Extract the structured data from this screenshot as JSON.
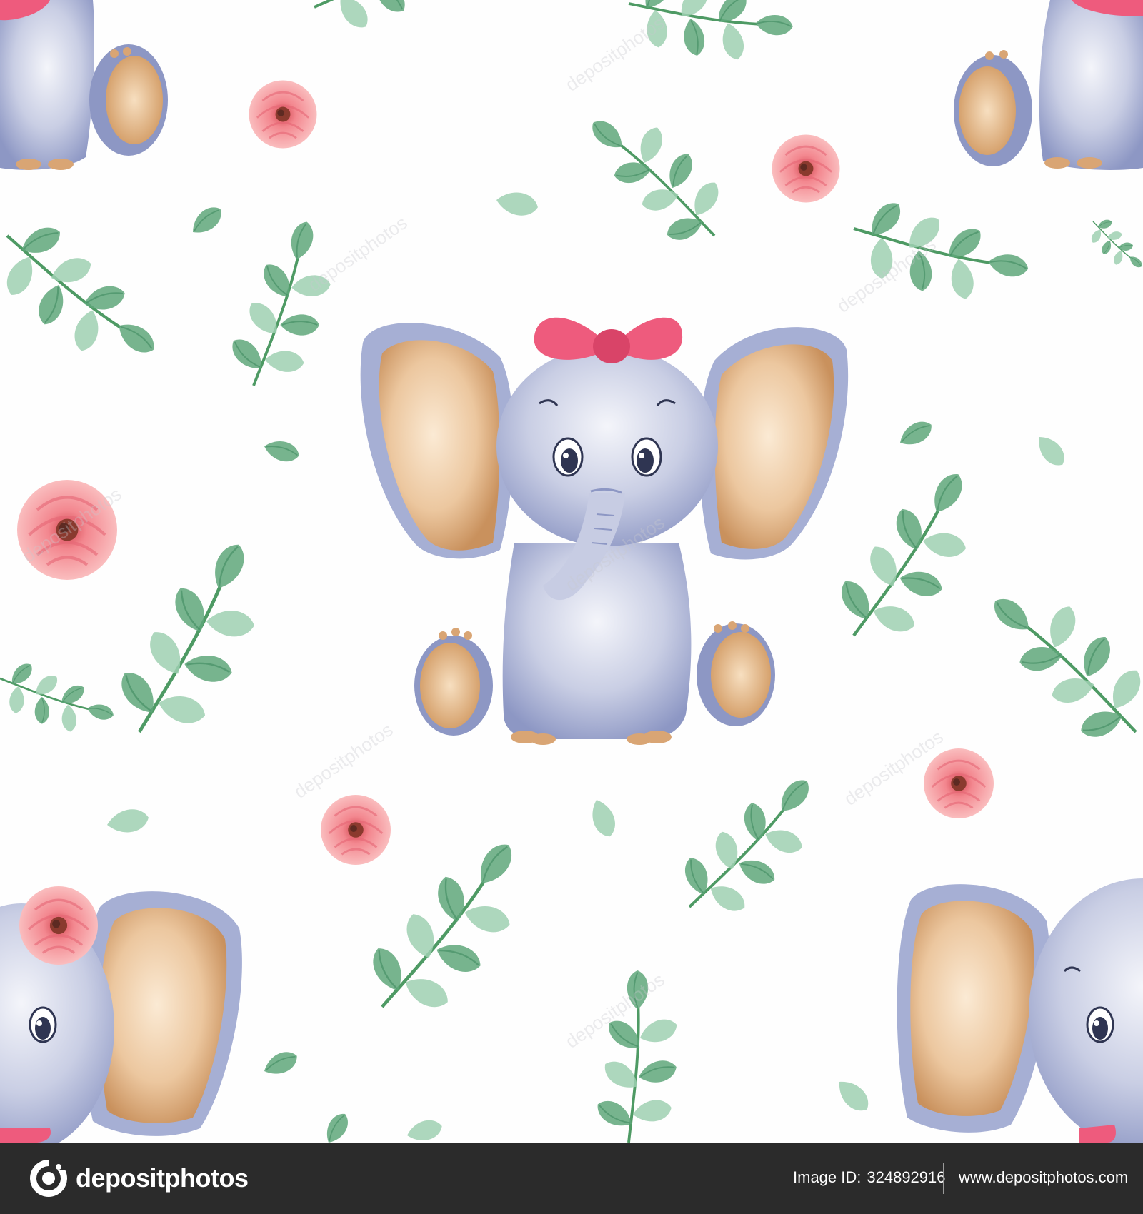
{
  "illustration": {
    "subject": "watercolor baby elephant seamless pattern",
    "colors": {
      "elephant_body": "#9fa9cf",
      "elephant_shade": "#7d89bd",
      "ear_inner": "#e4b98c",
      "bow": "#ee5b7d",
      "rose": "#f2838f",
      "leaf_dark": "#3f8b5f",
      "leaf_light": "#8fc5a3",
      "stem": "#4e9a64"
    },
    "watermark_text": "depositphotos"
  },
  "footer": {
    "brand_name": "depositphotos",
    "image_id_label": "Image ID:",
    "image_id_value": "324892916",
    "site_url": "www.depositphotos.com"
  }
}
